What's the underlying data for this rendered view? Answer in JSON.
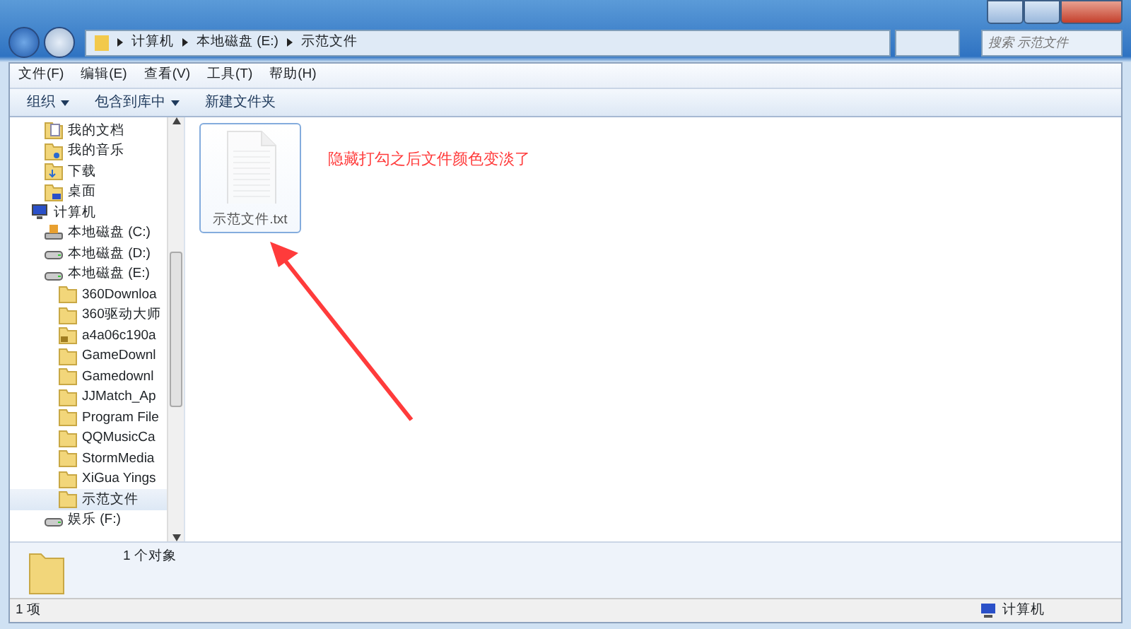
{
  "address_bar": {
    "crumbs": [
      "计算机",
      "本地磁盘 (E:)",
      "示范文件"
    ]
  },
  "search": {
    "placeholder": "搜索 示范文件"
  },
  "menu": [
    "文件(F)",
    "编辑(E)",
    "查看(V)",
    "工具(T)",
    "帮助(H)"
  ],
  "toolbar": [
    {
      "label": "组织",
      "dropdown": true
    },
    {
      "label": "包含到库中",
      "dropdown": true
    },
    {
      "label": "新建文件夹",
      "dropdown": false
    }
  ],
  "tree": [
    {
      "children": [
        {
          "label": "我的文档",
          "kind": "document",
          "selected": false
        },
        {
          "label": "我的音乐",
          "kind": "music",
          "selected": false
        },
        {
          "label": "下载",
          "kind": "download",
          "selected": false
        },
        {
          "label": "桌面",
          "kind": "desktop",
          "selected": false
        }
      ]
    },
    {
      "label": "计算机",
      "kind": "computer",
      "selected": false,
      "children": [
        {
          "label": "本地磁盘 (C:)",
          "kind": "system-drive",
          "selected": false
        },
        {
          "label": "本地磁盘 (D:)",
          "kind": "drive",
          "selected": false
        },
        {
          "label": "本地磁盘 (E:)",
          "kind": "drive",
          "selected": false,
          "children": [
            {
              "label": "360Downloa",
              "kind": "folder",
              "selected": false
            },
            {
              "label": "360驱动大师",
              "kind": "folder",
              "selected": false
            },
            {
              "label": "a4a06c190a",
              "kind": "locked-folder",
              "selected": false
            },
            {
              "label": "GameDownl",
              "kind": "folder",
              "selected": false
            },
            {
              "label": "Gamedownl",
              "kind": "folder",
              "selected": false
            },
            {
              "label": "JJMatch_Ap",
              "kind": "folder",
              "selected": false
            },
            {
              "label": "Program File",
              "kind": "folder",
              "selected": false
            },
            {
              "label": "QQMusicCa",
              "kind": "folder",
              "selected": false
            },
            {
              "label": "StormMedia",
              "kind": "folder",
              "selected": false
            },
            {
              "label": "XiGua Yings",
              "kind": "folder",
              "selected": false
            },
            {
              "label": "示范文件",
              "kind": "folder",
              "selected": true
            }
          ]
        },
        {
          "label": "娱乐 (F:)",
          "kind": "drive",
          "selected": false
        }
      ]
    }
  ],
  "files": [
    {
      "name": "示范文件.txt",
      "kind": "text",
      "hidden": true,
      "selected": false
    }
  ],
  "annotation": {
    "text": "隐藏打勾之后文件颜色变淡了",
    "color": "#ff3b3b"
  },
  "details_pane": {
    "summary": "1 个对象"
  },
  "status_bar": {
    "count": "1 项",
    "location": "计算机"
  }
}
